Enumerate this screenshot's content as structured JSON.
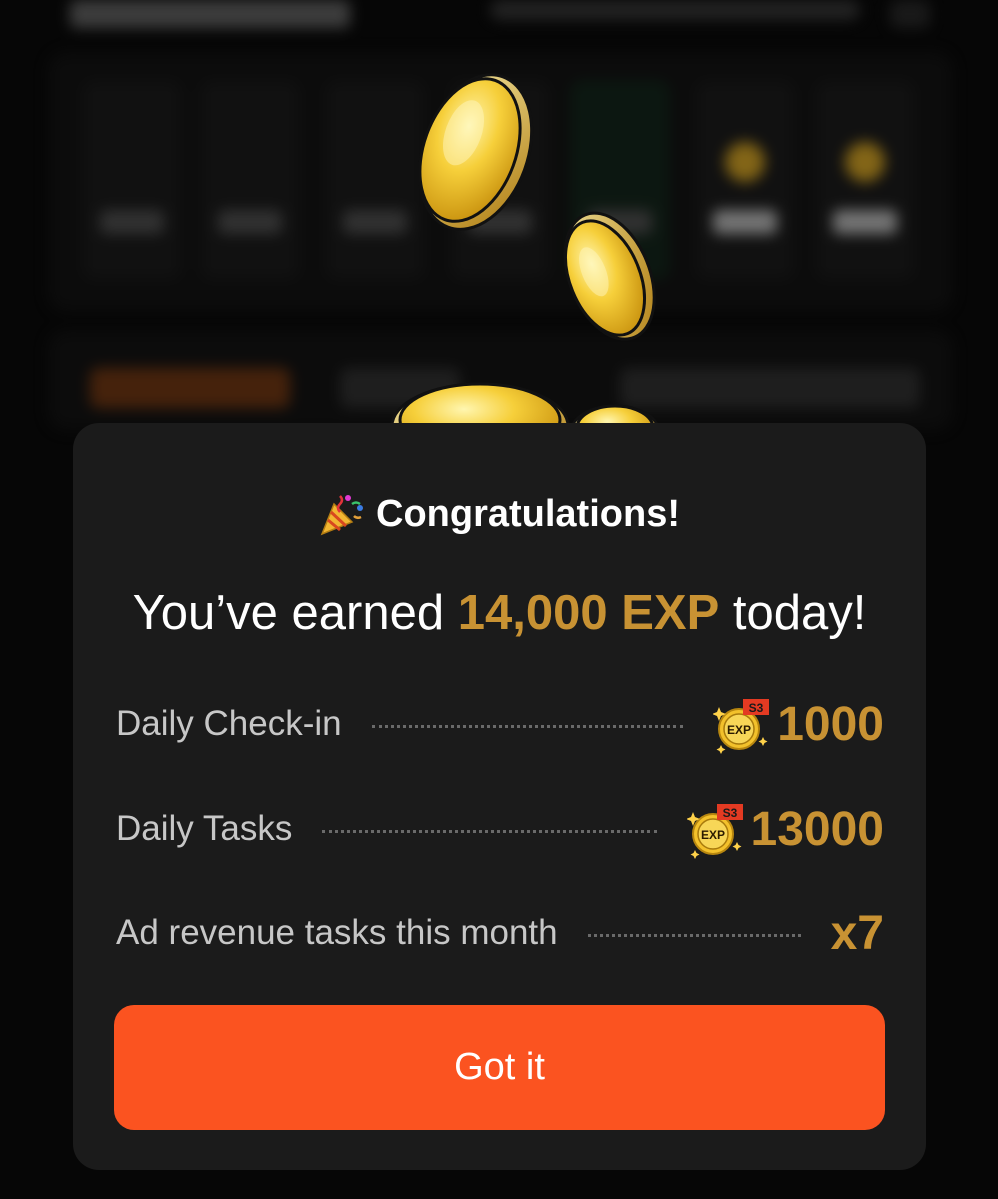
{
  "modal": {
    "title": "Congratulations!",
    "headline_prefix": "You’ve earned",
    "headline_amount": "14,000 EXP",
    "headline_suffix": "today!",
    "rows": [
      {
        "label": "Daily Check-in",
        "value": "1000",
        "icon": "exp-s3-badge-icon"
      },
      {
        "label": "Daily Tasks",
        "value": "13000",
        "icon": "exp-s3-badge-icon"
      },
      {
        "label": "Ad revenue tasks this month",
        "value": "x7"
      }
    ],
    "button_label": "Got it"
  },
  "badge": {
    "exp_text": "EXP",
    "season_text": "S3"
  },
  "colors": {
    "accent_gold": "#c89233",
    "button_orange": "#fb5320",
    "modal_bg": "#1b1b1b"
  }
}
